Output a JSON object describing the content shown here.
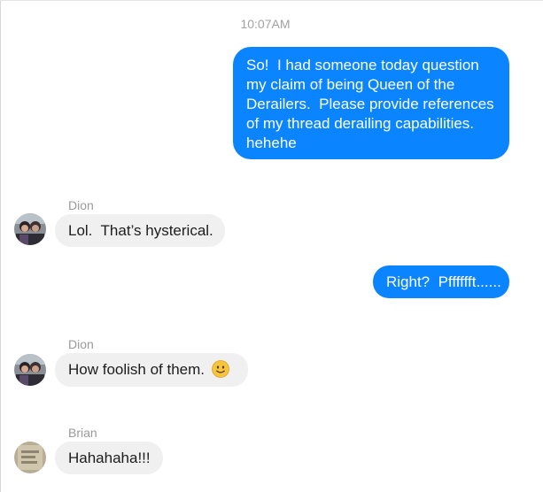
{
  "timestamp": "10:07AM",
  "messages": [
    {
      "direction": "outgoing",
      "text": "So!  I had someone today question my claim of being Queen of the Derailers.  Please provide references of my thread derailing capabilities. hehehe"
    },
    {
      "direction": "incoming",
      "sender": "Dion",
      "text": "Lol.  That’s hysterical."
    },
    {
      "direction": "outgoing",
      "text": "Right?  Pfffffft......"
    },
    {
      "direction": "incoming",
      "sender": "Dion",
      "text": "How foolish of them.",
      "emoji": "slightly-smiling-face-icon"
    },
    {
      "direction": "incoming",
      "sender": "Brian",
      "text": "Hahahaha!!!"
    }
  ],
  "colors": {
    "outgoing_bubble": "#0a84ff",
    "incoming_bubble": "#f0f0f0",
    "sender_name": "#9a9a9a",
    "timestamp": "#a2a2a2"
  }
}
